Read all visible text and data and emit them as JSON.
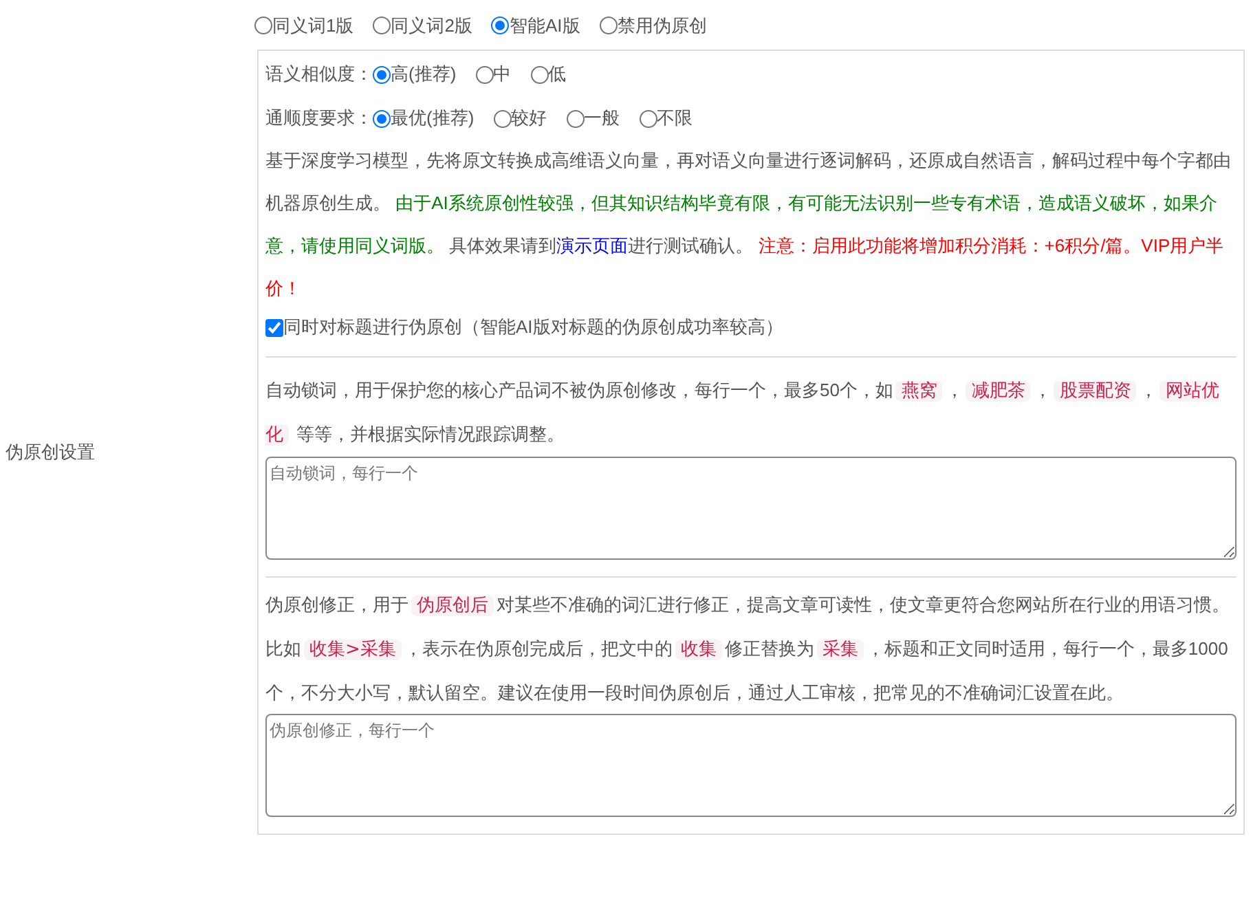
{
  "section_label": "伪原创设置",
  "modes": [
    {
      "label": "同义词1版",
      "selected": false
    },
    {
      "label": "同义词2版",
      "selected": false
    },
    {
      "label": "智能AI版",
      "selected": true
    },
    {
      "label": "禁用伪原创",
      "selected": false
    }
  ],
  "similarity": {
    "label": "语义相似度：",
    "options": [
      {
        "label": "高(推荐)",
        "selected": true
      },
      {
        "label": "中",
        "selected": false
      },
      {
        "label": "低",
        "selected": false
      }
    ]
  },
  "fluency": {
    "label": "通顺度要求：",
    "options": [
      {
        "label": "最优(推荐)",
        "selected": true
      },
      {
        "label": "较好",
        "selected": false
      },
      {
        "label": "一般",
        "selected": false
      },
      {
        "label": "不限",
        "selected": false
      }
    ]
  },
  "ai_description": [
    {
      "kind": "plain",
      "text": "基于深度学习模型，先将原文转换成高维语义向量，再对语义向量进行逐词解码，还原成自然语言，解码过程中每个字都由机器原创生成。 "
    },
    {
      "kind": "green",
      "text": "由于AI系统原创性较强，但其知识结构毕竟有限，有可能无法识别一些专有术语，造成语义破坏，如果介意，请使用同义词版。"
    },
    {
      "kind": "plain",
      "text": " 具体效果请到"
    },
    {
      "kind": "link",
      "text": "演示页面"
    },
    {
      "kind": "plain",
      "text": "进行测试确认。 "
    },
    {
      "kind": "red",
      "text": "注意：启用此功能将增加积分消耗：+6积分/篇。VIP用户半价！"
    }
  ],
  "title_option": {
    "label": "同时对标题进行伪原创（智能AI版对标题的伪原创成功率较高）",
    "checked": true
  },
  "lock_words": {
    "description": [
      {
        "kind": "text",
        "text": "自动锁词，用于保护您的核心产品词不被伪原创修改，每行一个，最多50个，如"
      },
      {
        "kind": "tag",
        "text": "燕窝"
      },
      {
        "kind": "text",
        "text": "，"
      },
      {
        "kind": "tag",
        "text": "减肥茶"
      },
      {
        "kind": "text",
        "text": "，"
      },
      {
        "kind": "tag",
        "text": "股票配资"
      },
      {
        "kind": "text",
        "text": "，"
      },
      {
        "kind": "tag",
        "text": "网站优化"
      },
      {
        "kind": "text",
        "text": " 等等，并根据实际情况跟踪调整。"
      }
    ],
    "placeholder": "自动锁词，每行一个"
  },
  "corrections": {
    "description": [
      {
        "kind": "text",
        "text": "伪原创修正，用于"
      },
      {
        "kind": "tag",
        "text": "伪原创后"
      },
      {
        "kind": "text",
        "text": "对某些不准确的词汇进行修正，提高文章可读性，使文章更符合您网站所在行业的用语习惯。比如"
      },
      {
        "kind": "tag",
        "text": "收集>采集"
      },
      {
        "kind": "text",
        "text": "，表示在伪原创完成后，把文中的"
      },
      {
        "kind": "tag",
        "text": "收集"
      },
      {
        "kind": "text",
        "text": "修正替换为"
      },
      {
        "kind": "tag",
        "text": "采集"
      },
      {
        "kind": "text",
        "text": "，标题和正文同时适用，每行一个，最多1000个，不分大小写，默认留空。建议在使用一段时间伪原创后，通过人工审核，把常见的不准确词汇设置在此。"
      }
    ],
    "placeholder": "伪原创修正，每行一个"
  }
}
